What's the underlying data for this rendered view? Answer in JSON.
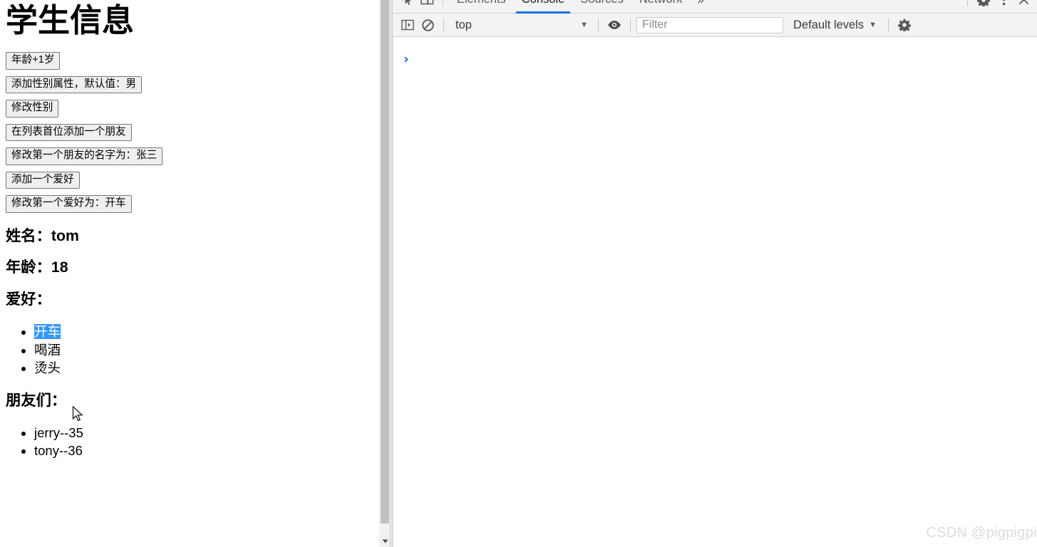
{
  "page": {
    "title": "学生信息",
    "buttons": [
      {
        "name": "age-plus-one",
        "label": "年龄+1岁"
      },
      {
        "name": "add-gender-attr",
        "label": "添加性别属性，默认值：男"
      },
      {
        "name": "modify-gender",
        "label": "修改性别"
      },
      {
        "name": "add-friend-at-head",
        "label": "在列表首位添加一个朋友"
      },
      {
        "name": "rename-first-friend",
        "label": "修改第一个朋友的名字为：张三"
      },
      {
        "name": "add-hobby",
        "label": "添加一个爱好"
      },
      {
        "name": "modify-first-hobby",
        "label": "修改第一个爱好为：开车"
      }
    ],
    "fields": {
      "name_label": "姓名：",
      "name_value": "tom",
      "age_label": "年龄：",
      "age_value": "18",
      "hobbies_label": "爱好：",
      "friends_label": "朋友们："
    },
    "hobbies": [
      {
        "value": "开车",
        "selected": true
      },
      {
        "value": "喝酒",
        "selected": false
      },
      {
        "value": "烫头",
        "selected": false
      }
    ],
    "friends": [
      {
        "value": "jerry--35"
      },
      {
        "value": "tony--36"
      }
    ],
    "selection_color": "#3297fd",
    "scrollbar": {
      "thumb_color": "#c1c1c1",
      "track_color": "#f1f1f1"
    }
  },
  "devtools": {
    "tabs": [
      {
        "label": "Elements",
        "active": false
      },
      {
        "label": "Console",
        "active": true
      },
      {
        "label": "Sources",
        "active": false
      },
      {
        "label": "Network",
        "active": false
      }
    ],
    "more_tabs_label": "»",
    "left_icons": [
      {
        "name": "inspect-element-icon"
      },
      {
        "name": "device-toolbar-icon"
      }
    ],
    "right_icons": [
      {
        "name": "gear-icon"
      },
      {
        "name": "kebab-menu-icon"
      },
      {
        "name": "close-icon"
      }
    ],
    "console_toolbar": {
      "sidebar_toggle_icon": "console-sidebar-icon",
      "clear_console_icon": "clear-console-icon",
      "context": "top",
      "context_caret": "▼",
      "eye_icon": "eye-icon",
      "filter_placeholder": "Filter",
      "filter_value": "",
      "levels_label": "Default levels",
      "levels_caret": "▼",
      "settings_icon": "gear-icon"
    },
    "prompt_symbol": "›",
    "active_tab_underline_color": "#1a73e8"
  },
  "watermark": {
    "text": "CSDN @pigpigpi"
  }
}
